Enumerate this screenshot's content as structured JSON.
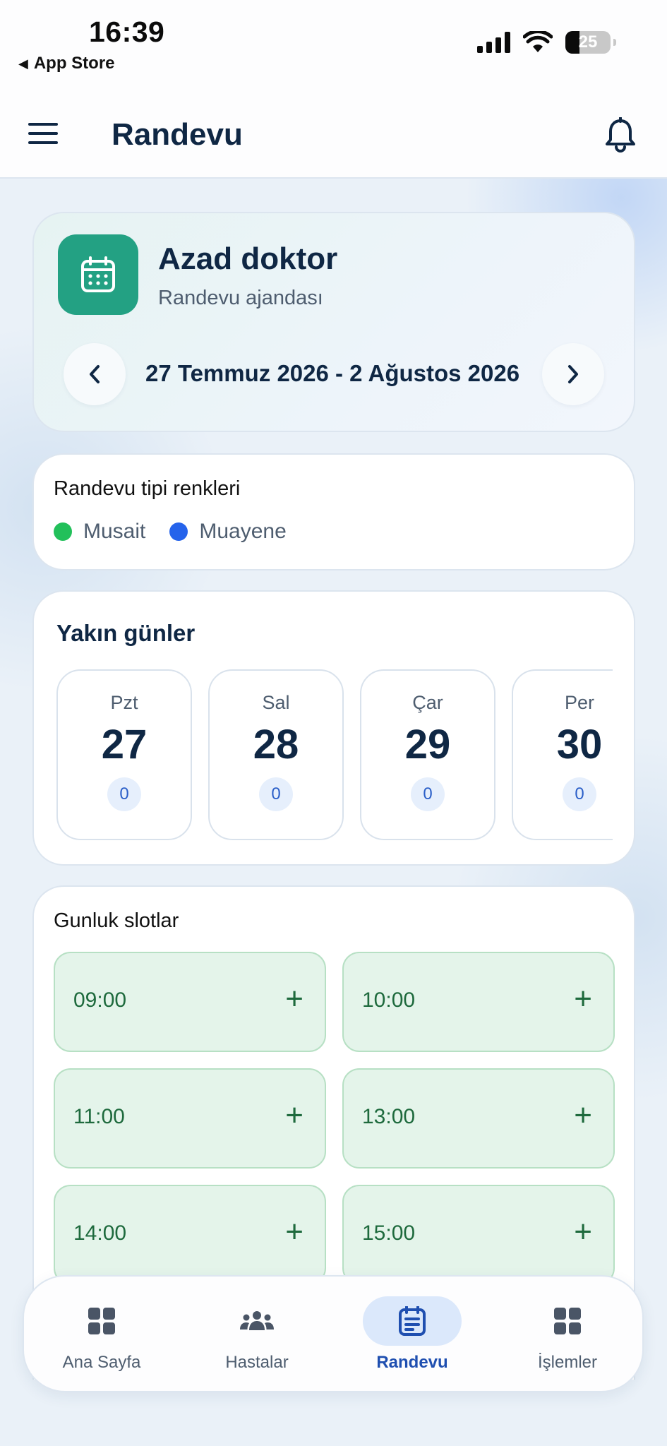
{
  "status_bar": {
    "time": "16:39",
    "back_label": "App Store",
    "battery_level": "25"
  },
  "header": {
    "title": "Randevu",
    "menu_icon": "hamburger-icon",
    "notification_icon": "bell-icon"
  },
  "hero": {
    "title": "Azad doktor",
    "subtitle": "Randevu ajandası",
    "date_range": "27 Temmuz 2026 - 2 Ağustos 2026",
    "badge_icon": "calendar-icon",
    "badge_color": "#23a183"
  },
  "legend": {
    "title": "Randevu tipi renkleri",
    "items": [
      {
        "label": "Musait",
        "color": "#22c05a"
      },
      {
        "label": "Muayene",
        "color": "#2563eb"
      }
    ]
  },
  "days": {
    "title": "Yakın günler",
    "items": [
      {
        "name": "Pzt",
        "num": "27",
        "count": "0"
      },
      {
        "name": "Sal",
        "num": "28",
        "count": "0"
      },
      {
        "name": "Çar",
        "num": "29",
        "count": "0"
      },
      {
        "name": "Per",
        "num": "30",
        "count": "0"
      }
    ]
  },
  "slots": {
    "title": "Gunluk slotlar",
    "items": [
      {
        "time": "09:00",
        "action": "+"
      },
      {
        "time": "10:00",
        "action": "+"
      },
      {
        "time": "11:00",
        "action": "+"
      },
      {
        "time": "13:00",
        "action": "+"
      },
      {
        "time": "14:00",
        "action": "+"
      },
      {
        "time": "15:00",
        "action": "+"
      }
    ],
    "slot_color": "#e4f4ea"
  },
  "bottom_nav": {
    "items": [
      {
        "label": "Ana Sayfa",
        "icon": "grid-icon"
      },
      {
        "label": "Hastalar",
        "icon": "users-icon"
      },
      {
        "label": "Randevu",
        "icon": "calendar-icon",
        "active": true
      },
      {
        "label": "İşlemler",
        "icon": "grid-icon"
      }
    ],
    "active_color": "#1f4fb0"
  }
}
